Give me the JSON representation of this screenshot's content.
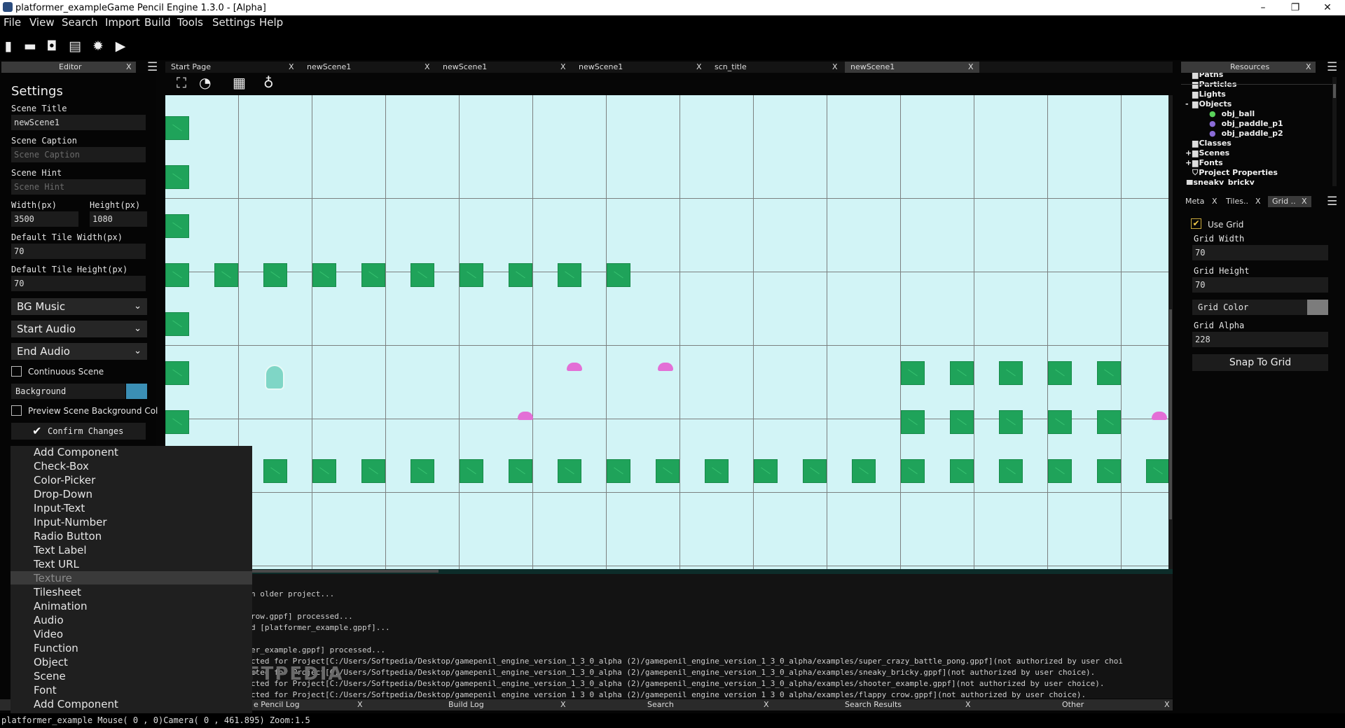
{
  "window": {
    "title": "platformer_exampleGame Pencil Engine  1.3.0 - [Alpha]",
    "minimize": "–",
    "restore": "❐",
    "close": "✕"
  },
  "menu": [
    "File",
    "View",
    "Search",
    "Import",
    "Build",
    "Tools",
    "Settings",
    "Help"
  ],
  "toolbar": {
    "icons": [
      "new-file-icon",
      "open-folder-icon",
      "save-icon",
      "save-all-icon",
      "settings-icon",
      "play-icon"
    ]
  },
  "editor_panel": {
    "tab": "Editor",
    "close": "X"
  },
  "settings": {
    "heading": "Settings",
    "scene_title_label": "Scene Title",
    "scene_title_value": "newScene1",
    "scene_caption_label": "Scene Caption",
    "scene_caption_placeholder": "Scene Caption",
    "scene_hint_label": "Scene Hint",
    "scene_hint_placeholder": "Scene Hint",
    "width_label": "Width(px)",
    "width_value": "3500",
    "height_label": "Height(px)",
    "height_value": "1080",
    "tile_width_label": "Default Tile Width(px)",
    "tile_width_value": "70",
    "tile_height_label": "Default Tile Height(px)",
    "tile_height_value": "70",
    "bg_music": "BG Music",
    "start_audio": "Start Audio",
    "end_audio": "End Audio",
    "continuous_scene": "Continuous Scene",
    "background": "Background",
    "background_color": "#3b8fb5",
    "preview_bg": "Preview Scene Background Col",
    "confirm": "Confirm Changes"
  },
  "context_menu": [
    "Add Component",
    "Check-Box",
    "Color-Picker",
    "Drop-Down",
    "Input-Text",
    "Input-Number",
    "Radio Button",
    "Text Label",
    "Text URL",
    "Texture",
    "Tilesheet",
    "Animation",
    "Audio",
    "Video",
    "Function",
    "Object",
    "Scene",
    "Font",
    "Add Component"
  ],
  "context_menu_highlight": "Texture",
  "tabs": [
    {
      "label": "Start Page",
      "close": "X"
    },
    {
      "label": "newScene1",
      "close": "X"
    },
    {
      "label": "newScene1",
      "close": "X"
    },
    {
      "label": "newScene1",
      "close": "X"
    },
    {
      "label": "scn_title",
      "close": "X"
    },
    {
      "label": "newScene1",
      "close": "X",
      "active": true
    }
  ],
  "scene_colors": {
    "background": "#d2f4f6",
    "tile": "#1fa35a",
    "enemy": "#e36fd6"
  },
  "resources": {
    "tab": "Resources",
    "close": "X",
    "items": [
      {
        "label": "Paths",
        "prefix": ""
      },
      {
        "label": "Particles",
        "prefix": ""
      },
      {
        "label": "Lights",
        "prefix": ""
      },
      {
        "label": "Objects",
        "prefix": "-"
      },
      {
        "label": "obj_ball",
        "prefix": ""
      },
      {
        "label": "obj_paddle_p1",
        "prefix": ""
      },
      {
        "label": "obj_paddle_p2",
        "prefix": ""
      },
      {
        "label": "Classes",
        "prefix": ""
      },
      {
        "label": "Scenes",
        "prefix": "+"
      },
      {
        "label": "Fonts",
        "prefix": "+"
      },
      {
        "label": "Project Properties",
        "prefix": ""
      },
      {
        "label": "sneaky_bricky",
        "prefix": ""
      }
    ]
  },
  "inspector": {
    "tabs": [
      {
        "label": "Meta",
        "close": "X"
      },
      {
        "label": "Tiles..",
        "close": "X"
      },
      {
        "label": "Grid ..",
        "close": "X",
        "active": true
      }
    ],
    "use_grid": "Use Grid",
    "grid_width_label": "Grid Width",
    "grid_width": "70",
    "grid_height_label": "Grid Height",
    "grid_height": "70",
    "grid_color_label": "Grid Color",
    "grid_color": "#7c7c7c",
    "grid_alpha_label": "Grid Alpha",
    "grid_alpha": "228",
    "snap": "Snap To Grid"
  },
  "console": [
    "n older project...",
    "",
    "row.gppf] processed...",
    "d [platformer_example.gppf]...",
    "",
    "er_example.gppf] processed...",
    "cted for Project[C:/Users/Softpedia/Desktop/gamepenil_engine_version_1_3_0_alpha (2)/gamepenil_engine_version_1_3_0_alpha/examples/super_crazy_battle_pong.gppf](not authorized by user choi",
    "cted for Project[C:/Users/Softpedia/Desktop/gamepenil_engine_version_1_3_0_alpha (2)/gamepenil_engine_version_1_3_0_alpha/examples/sneaky_bricky.gppf](not authorized by user choice).",
    "cted for Project[C:/Users/Softpedia/Desktop/gamepenil_engine_version_1_3_0_alpha (2)/gamepenil_engine_version_1_3_0_alpha/examples/shooter_example.gppf](not authorized by user choice).",
    "cted for Project[C:/Users/Softpedia/Desktop/gamepenil_engine_version_1_3_0_alpha (2)/gamepenil_engine_version_1_3_0_alpha/examples/flappy_crow.gppf](not authorized by user choice)."
  ],
  "bottom_tabs": [
    {
      "label": "e Pencil Log",
      "close": "X"
    },
    {
      "label": "Build Log",
      "close": "X"
    },
    {
      "label": "Search",
      "close": "X"
    },
    {
      "label": "Search Results",
      "close": "X"
    },
    {
      "label": "Other",
      "close": "X"
    }
  ],
  "watermark": "SOFTPEDIA",
  "status": "platformer_example Mouse( 0 , 0)Camera( 0 , 461.895) Zoom:1.5"
}
